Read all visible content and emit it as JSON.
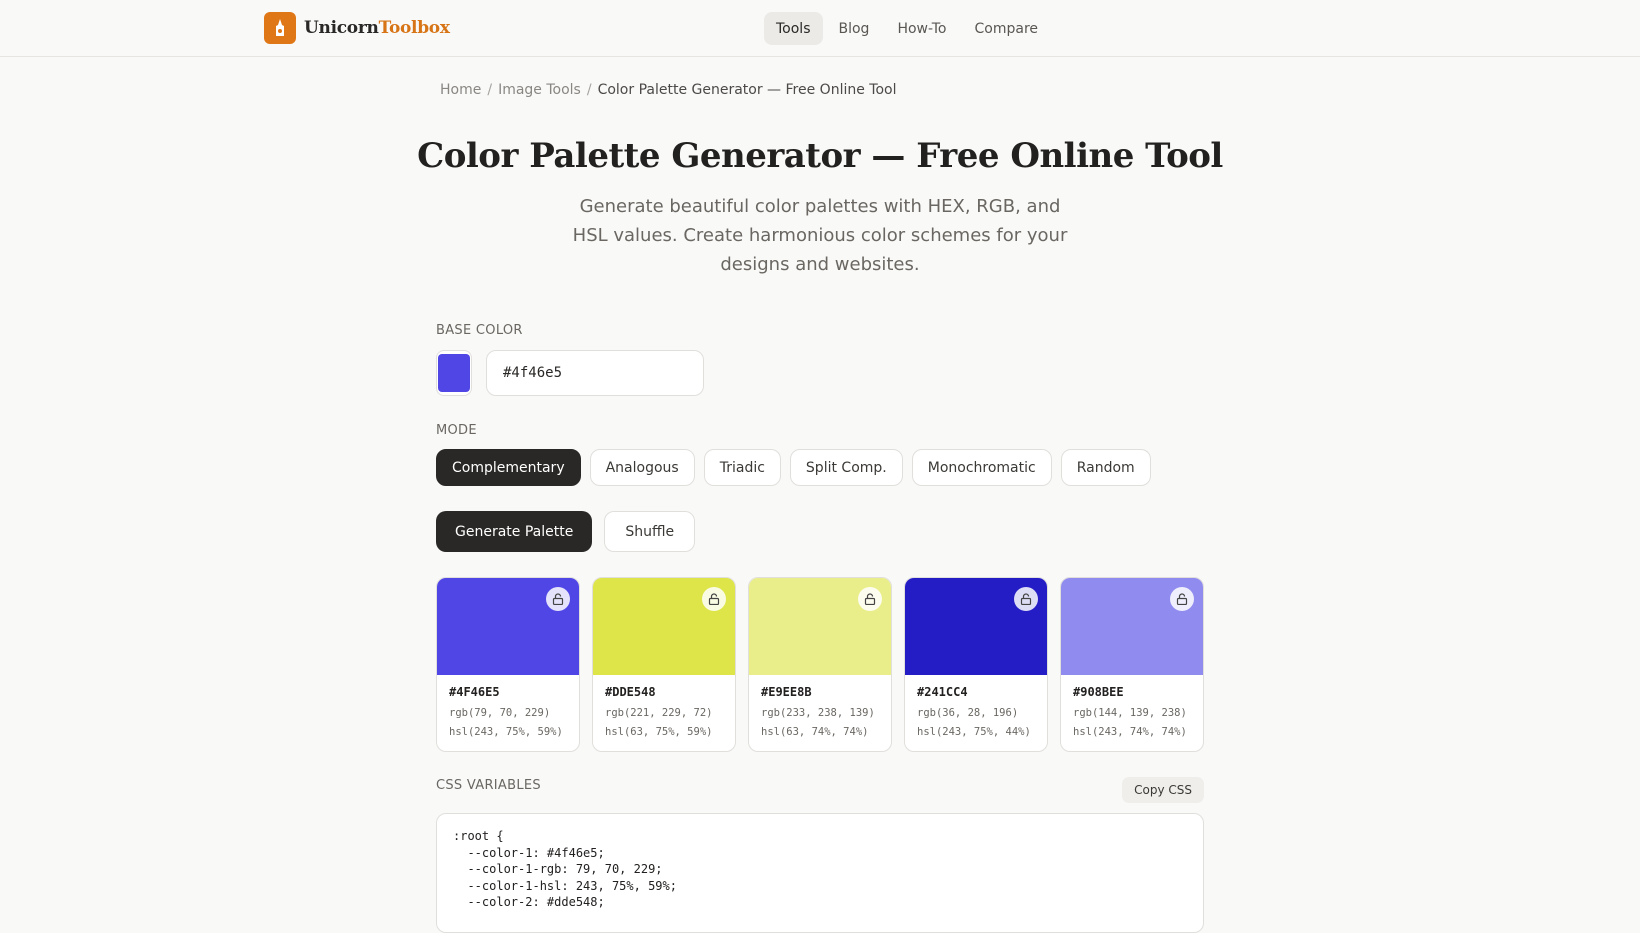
{
  "brand": {
    "name_part1": "Unicorn",
    "name_part2": "Toolbox",
    "accent": "#df7717"
  },
  "nav": [
    {
      "label": "Tools",
      "active": true
    },
    {
      "label": "Blog",
      "active": false
    },
    {
      "label": "How-To",
      "active": false
    },
    {
      "label": "Compare",
      "active": false
    }
  ],
  "breadcrumb": {
    "home": "Home",
    "section": "Image Tools",
    "current": "Color Palette Generator — Free Online Tool"
  },
  "page": {
    "title": "Color Palette Generator — Free Online Tool",
    "subtitle": "Generate beautiful color palettes with HEX, RGB, and HSL values. Create harmonious color schemes for your designs and websites."
  },
  "base_color": {
    "label": "BASE COLOR",
    "value": "#4f46e5"
  },
  "mode": {
    "label": "MODE",
    "options": [
      "Complementary",
      "Analogous",
      "Triadic",
      "Split Comp.",
      "Monochromatic",
      "Random"
    ],
    "selected": "Complementary"
  },
  "actions": {
    "generate": "Generate Palette",
    "shuffle": "Shuffle"
  },
  "palette": [
    {
      "color": "#4f46e5",
      "hex": "#4F46E5",
      "rgb": "rgb(79, 70, 229)",
      "hsl": "hsl(243, 75%, 59%)"
    },
    {
      "color": "#dde548",
      "hex": "#DDE548",
      "rgb": "rgb(221, 229, 72)",
      "hsl": "hsl(63, 75%, 59%)"
    },
    {
      "color": "#e9ee8b",
      "hex": "#E9EE8B",
      "rgb": "rgb(233, 238, 139)",
      "hsl": "hsl(63, 74%, 74%)"
    },
    {
      "color": "#241cc4",
      "hex": "#241CC4",
      "rgb": "rgb(36, 28, 196)",
      "hsl": "hsl(243, 75%, 44%)"
    },
    {
      "color": "#908bee",
      "hex": "#908BEE",
      "rgb": "rgb(144, 139, 238)",
      "hsl": "hsl(243, 74%, 74%)"
    }
  ],
  "css_vars": {
    "label": "CSS VARIABLES",
    "copy_label": "Copy CSS",
    "code": ":root {\n  --color-1: #4f46e5;\n  --color-1-rgb: 79, 70, 229;\n  --color-1-hsl: 243, 75%, 59%;\n  --color-2: #dde548;"
  }
}
